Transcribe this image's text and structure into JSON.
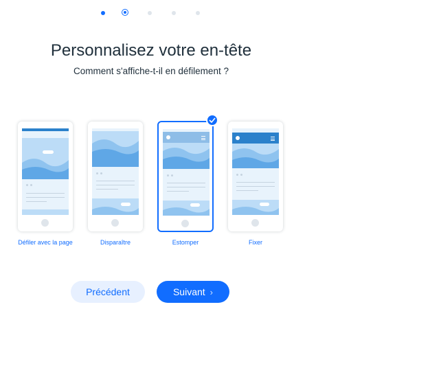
{
  "steps": {
    "total": 5,
    "current": 2
  },
  "title": "Personnalisez votre en-tête",
  "subtitle": "Comment s'affiche-t-il en défilement ?",
  "options": [
    {
      "label": "Défiler avec la page",
      "selected": false
    },
    {
      "label": "Disparaître",
      "selected": false
    },
    {
      "label": "Estomper",
      "selected": true
    },
    {
      "label": "Fixer",
      "selected": false
    }
  ],
  "buttons": {
    "previous": "Précédent",
    "next": "Suivant",
    "next_icon": "chevron-right-icon"
  },
  "colors": {
    "accent": "#116dff",
    "header_blue": "#2b81cb",
    "image_blue": "#bcdcf7",
    "screen_bg": "#e8f3fc",
    "text": "#20303c"
  }
}
